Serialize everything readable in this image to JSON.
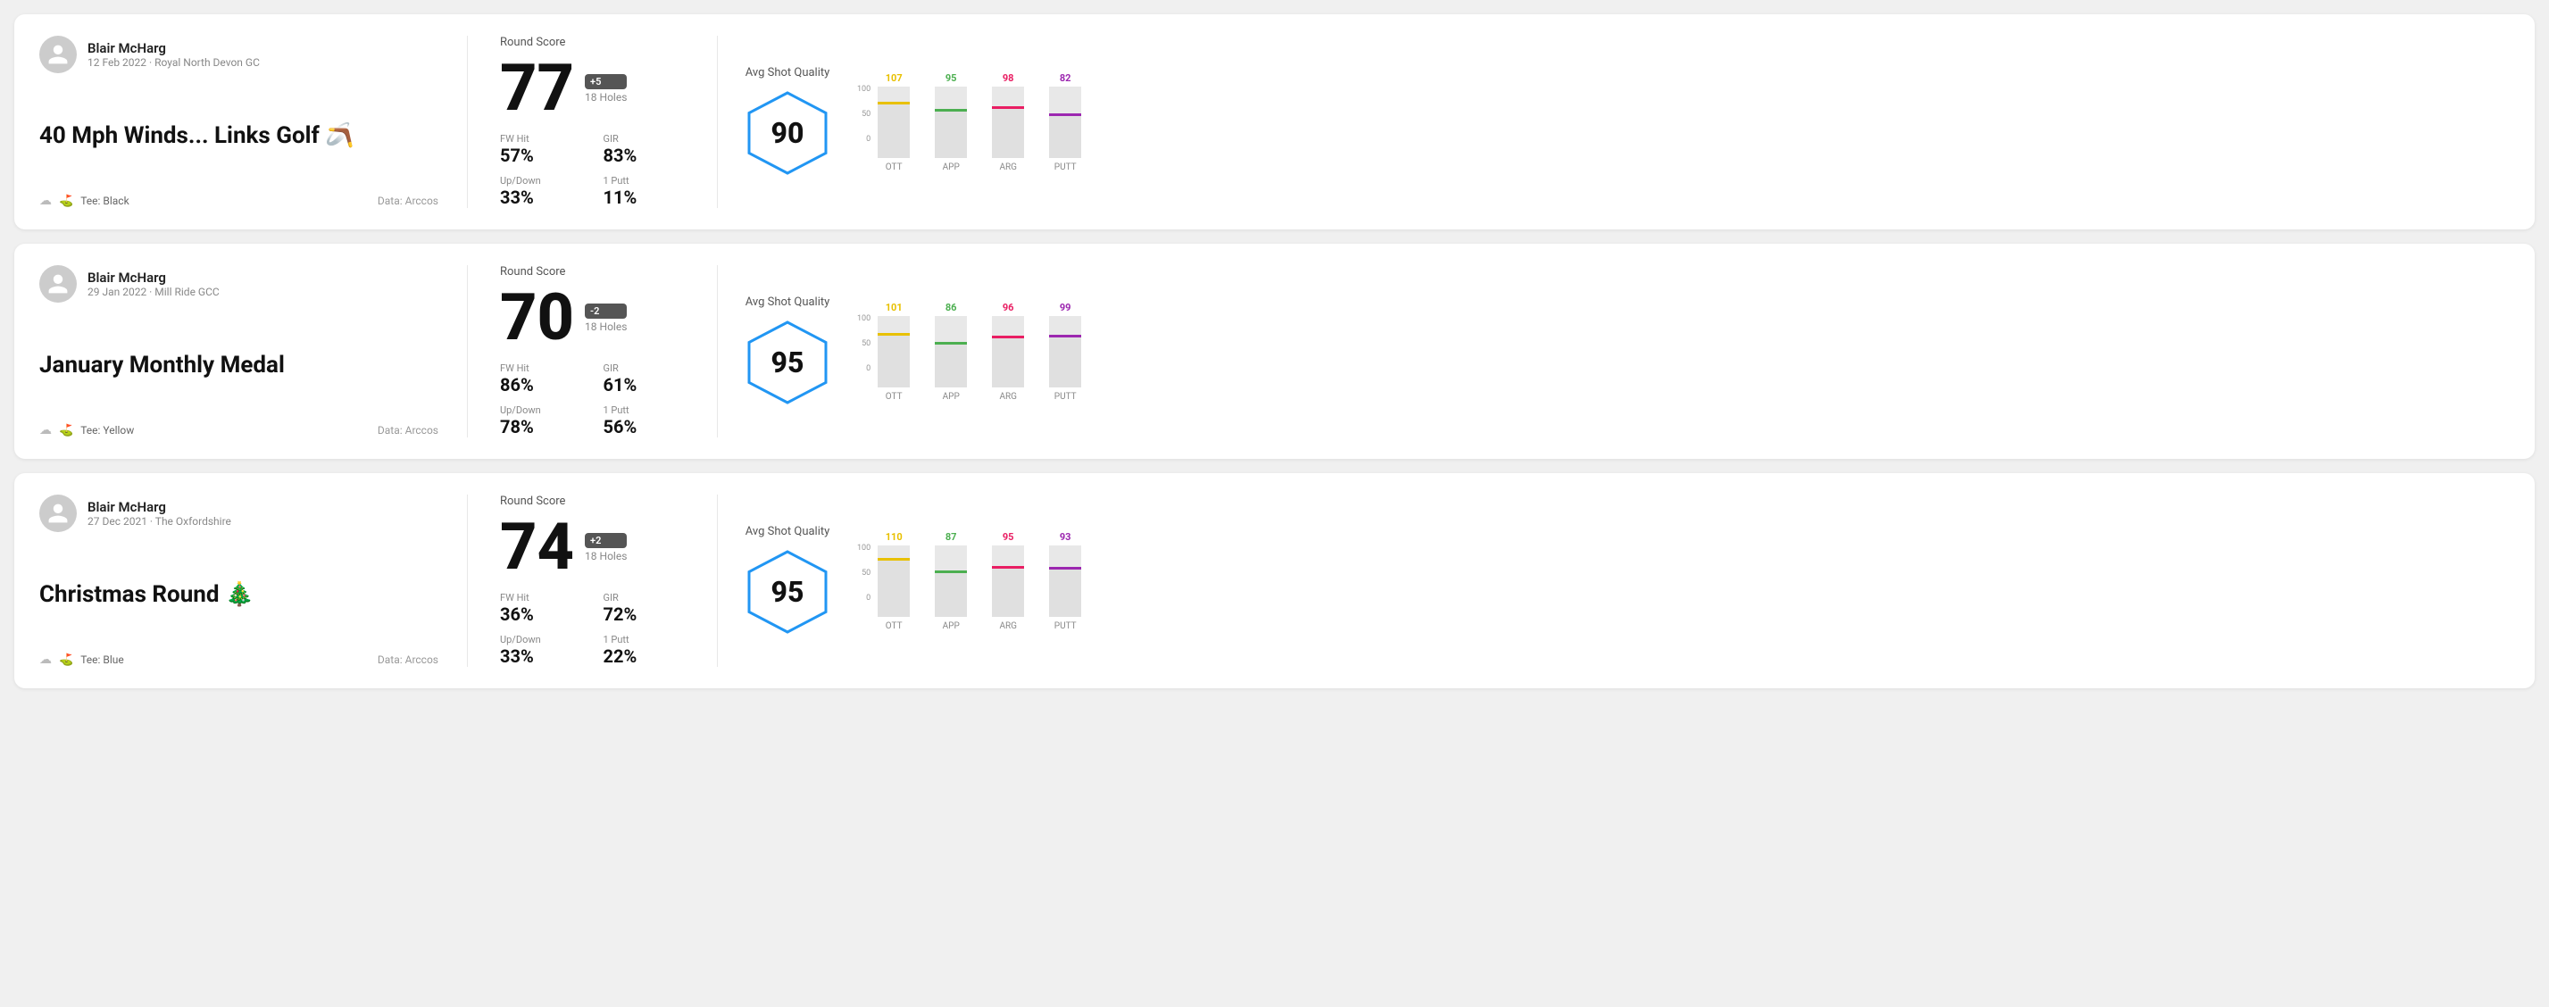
{
  "rounds": [
    {
      "id": "round-1",
      "player": {
        "name": "Blair McHarg",
        "meta": "12 Feb 2022 · Royal North Devon GC"
      },
      "title": "40 Mph Winds... Links Golf 🪃",
      "tee": "Black",
      "data_source": "Data: Arccos",
      "round_score_label": "Round Score",
      "score": "77",
      "score_diff": "+5",
      "holes": "18 Holes",
      "fw_hit_label": "FW Hit",
      "fw_hit": "57%",
      "gir_label": "GIR",
      "gir": "83%",
      "updown_label": "Up/Down",
      "updown": "33%",
      "oneputt_label": "1 Putt",
      "oneputt": "11%",
      "avg_quality_label": "Avg Shot Quality",
      "quality_score": "90",
      "chart": {
        "ott": {
          "value": 107,
          "color": "#e8c000",
          "bar_pct": 75
        },
        "app": {
          "value": 95,
          "color": "#4caf50",
          "bar_pct": 65
        },
        "arg": {
          "value": 98,
          "color": "#e91e63",
          "bar_pct": 68
        },
        "putt": {
          "value": 82,
          "color": "#9c27b0",
          "bar_pct": 58
        }
      }
    },
    {
      "id": "round-2",
      "player": {
        "name": "Blair McHarg",
        "meta": "29 Jan 2022 · Mill Ride GCC"
      },
      "title": "January Monthly Medal",
      "tee": "Yellow",
      "data_source": "Data: Arccos",
      "round_score_label": "Round Score",
      "score": "70",
      "score_diff": "-2",
      "holes": "18 Holes",
      "fw_hit_label": "FW Hit",
      "fw_hit": "86%",
      "gir_label": "GIR",
      "gir": "61%",
      "updown_label": "Up/Down",
      "updown": "78%",
      "oneputt_label": "1 Putt",
      "oneputt": "56%",
      "avg_quality_label": "Avg Shot Quality",
      "quality_score": "95",
      "chart": {
        "ott": {
          "value": 101,
          "color": "#e8c000",
          "bar_pct": 72
        },
        "app": {
          "value": 86,
          "color": "#4caf50",
          "bar_pct": 60
        },
        "arg": {
          "value": 96,
          "color": "#e91e63",
          "bar_pct": 68
        },
        "putt": {
          "value": 99,
          "color": "#9c27b0",
          "bar_pct": 70
        }
      }
    },
    {
      "id": "round-3",
      "player": {
        "name": "Blair McHarg",
        "meta": "27 Dec 2021 · The Oxfordshire"
      },
      "title": "Christmas Round 🎄",
      "tee": "Blue",
      "data_source": "Data: Arccos",
      "round_score_label": "Round Score",
      "score": "74",
      "score_diff": "+2",
      "holes": "18 Holes",
      "fw_hit_label": "FW Hit",
      "fw_hit": "36%",
      "gir_label": "GIR",
      "gir": "72%",
      "updown_label": "Up/Down",
      "updown": "33%",
      "oneputt_label": "1 Putt",
      "oneputt": "22%",
      "avg_quality_label": "Avg Shot Quality",
      "quality_score": "95",
      "chart": {
        "ott": {
          "value": 110,
          "color": "#e8c000",
          "bar_pct": 78
        },
        "app": {
          "value": 87,
          "color": "#4caf50",
          "bar_pct": 61
        },
        "arg": {
          "value": 95,
          "color": "#e91e63",
          "bar_pct": 67
        },
        "putt": {
          "value": 93,
          "color": "#9c27b0",
          "bar_pct": 66
        }
      }
    }
  ],
  "chart_y_labels": [
    "100",
    "50",
    "0"
  ],
  "chart_cols": [
    "OTT",
    "APP",
    "ARG",
    "PUTT"
  ]
}
